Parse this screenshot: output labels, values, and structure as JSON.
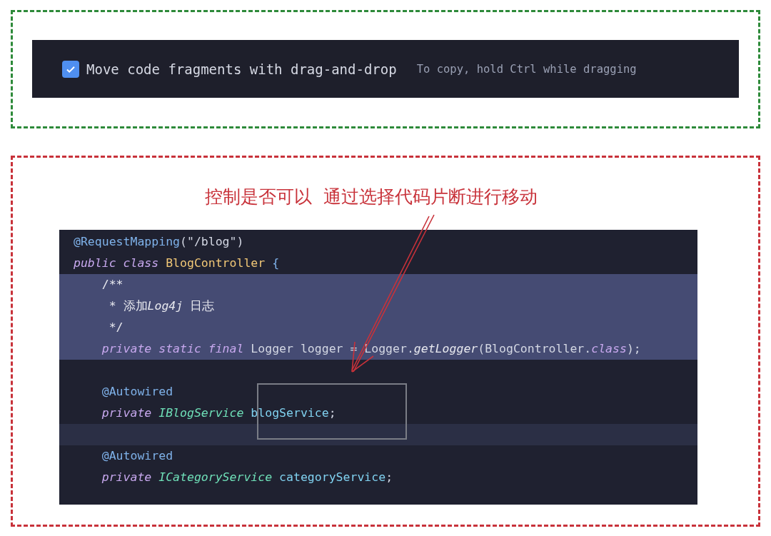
{
  "setting": {
    "label": "Move code fragments with drag-and-drop",
    "hint": "To copy, hold Ctrl while dragging",
    "checked": true
  },
  "annotation": {
    "text": "控制是否可以  通过选择代码片断进行移动"
  },
  "code_lines": [
    {
      "selected": false,
      "current": false,
      "tokens": [
        {
          "text": "@RequestMapping",
          "kind": "annotation"
        },
        {
          "text": "(\"/blog\")",
          "kind": "plain"
        }
      ]
    },
    {
      "selected": false,
      "current": false,
      "tokens": [
        {
          "text": "public class ",
          "kind": "keyword"
        },
        {
          "text": "BlogController ",
          "kind": "class"
        },
        {
          "text": "{",
          "kind": "brace"
        }
      ]
    },
    {
      "selected": true,
      "current": false,
      "tokens": [
        {
          "text": "    /**",
          "kind": "comment"
        }
      ]
    },
    {
      "selected": true,
      "current": false,
      "tokens": [
        {
          "text": "     * 添加",
          "kind": "comment"
        },
        {
          "text": "Log4j",
          "kind": "comment-italic"
        },
        {
          "text": " 日志",
          "kind": "comment"
        }
      ]
    },
    {
      "selected": true,
      "current": false,
      "tokens": [
        {
          "text": "     */",
          "kind": "comment"
        }
      ]
    },
    {
      "selected": true,
      "current": false,
      "tokens": [
        {
          "text": "    private static final ",
          "kind": "keyword"
        },
        {
          "text": "Logger logger = Logger.",
          "kind": "plain"
        },
        {
          "text": "getLogger",
          "kind": "method"
        },
        {
          "text": "(BlogController.",
          "kind": "plain"
        },
        {
          "text": "class",
          "kind": "keyword"
        },
        {
          "text": ");",
          "kind": "plain"
        }
      ]
    },
    {
      "selected": false,
      "current": false
    },
    {
      "selected": false,
      "current": false,
      "tokens": [
        {
          "text": "    @Autowired",
          "kind": "annotation"
        }
      ]
    },
    {
      "selected": false,
      "current": false,
      "tokens": [
        {
          "text": "    private ",
          "kind": "keyword"
        },
        {
          "text": "IBlogService ",
          "kind": "type"
        },
        {
          "text": "blogService",
          "kind": "field"
        },
        {
          "text": ";",
          "kind": "plain"
        }
      ]
    },
    {
      "selected": false,
      "current": true
    },
    {
      "selected": false,
      "current": false,
      "tokens": [
        {
          "text": "    @Autowired",
          "kind": "annotation"
        }
      ]
    },
    {
      "selected": false,
      "current": false,
      "tokens": [
        {
          "text": "    private ",
          "kind": "keyword"
        },
        {
          "text": "ICategoryService ",
          "kind": "type"
        },
        {
          "text": "categoryService",
          "kind": "field"
        },
        {
          "text": ";",
          "kind": "plain"
        }
      ]
    }
  ]
}
